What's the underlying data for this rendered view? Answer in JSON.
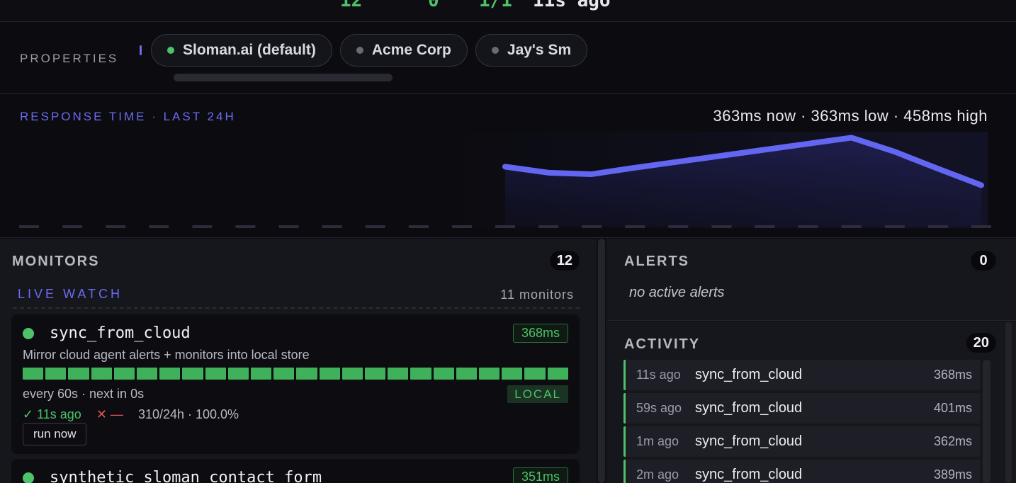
{
  "top_fragments": [
    {
      "text": "12",
      "tone": "g"
    },
    {
      "text": "0",
      "tone": "g"
    },
    {
      "text": "1/1",
      "tone": "g"
    },
    {
      "text": "11s ago",
      "tone": "w"
    }
  ],
  "properties": {
    "label": "PROPERTIES",
    "chips": [
      {
        "label": "Sloman.ai (default)",
        "active": true
      },
      {
        "label": "Acme Corp",
        "active": false
      },
      {
        "label": "Jay's Sm",
        "active": false
      }
    ]
  },
  "response": {
    "title": "RESPONSE TIME · LAST 24H",
    "summary": "363ms now · 363ms low · 458ms high",
    "accent": "#6366f1"
  },
  "chart_data": {
    "type": "area",
    "title": "RESPONSE TIME · LAST 24H",
    "xlabel": "",
    "ylabel": "",
    "grid": false,
    "series": [
      {
        "values": [
          null,
          null,
          null,
          null,
          null,
          null,
          null,
          null,
          null,
          null,
          null,
          400,
          388,
          385,
          398,
          410,
          422,
          434,
          446,
          458,
          430,
          396,
          363
        ]
      }
    ],
    "ylim": [
      280,
      470
    ]
  },
  "monitors": {
    "title": "MONITORS",
    "count": "12",
    "live_watch": "LIVE WATCH",
    "live_count": "11 monitors",
    "cards": [
      {
        "name": "sync_from_cloud",
        "latency": "368ms",
        "description": "Mirror cloud agent alerts + monitors into local store",
        "bars": 24,
        "schedule": "every 60s · next in 0s",
        "tag": "LOCAL",
        "last_ok": "✓ 11s ago",
        "last_err": "✕ —",
        "uptime": "310/24h · 100.0%",
        "run_label": "run now"
      },
      {
        "name": "synthetic_sloman_contact_form",
        "latency": "351ms"
      }
    ]
  },
  "alerts": {
    "title": "ALERTS",
    "count": "0",
    "empty": "no active alerts"
  },
  "activity": {
    "title": "ACTIVITY",
    "count": "20",
    "rows": [
      {
        "ago": "11s ago",
        "name": "sync_from_cloud",
        "ms": "368ms"
      },
      {
        "ago": "59s ago",
        "name": "sync_from_cloud",
        "ms": "401ms"
      },
      {
        "ago": "1m ago",
        "name": "sync_from_cloud",
        "ms": "362ms"
      },
      {
        "ago": "2m ago",
        "name": "sync_from_cloud",
        "ms": "389ms"
      }
    ]
  },
  "colors": {
    "ok": "#4ec26a",
    "accent": "#6366f1",
    "error": "#e05555"
  }
}
